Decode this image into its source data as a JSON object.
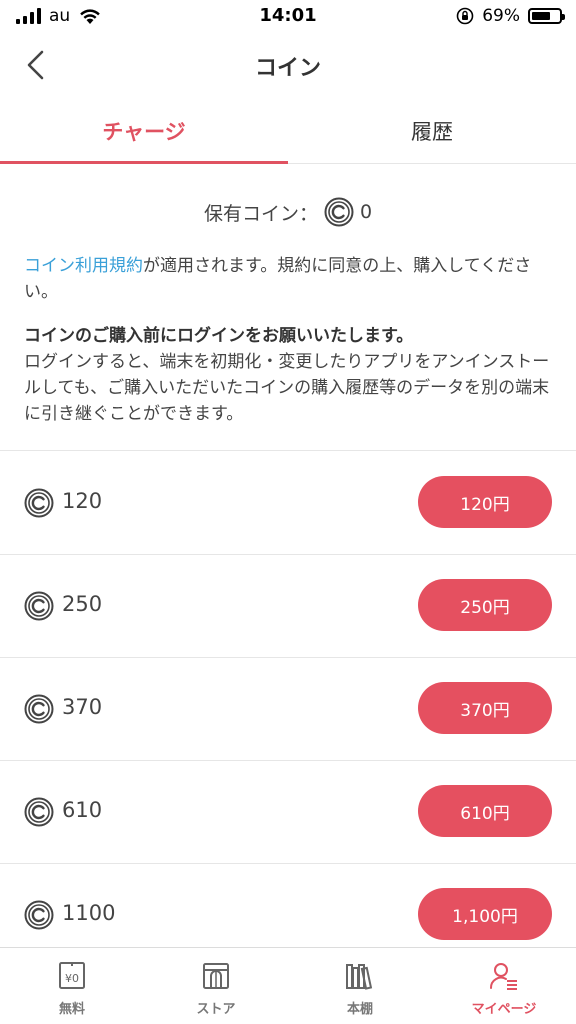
{
  "status_bar": {
    "carrier": "au",
    "time": "14:01",
    "battery_percent": "69%",
    "battery_level": 0.69
  },
  "header": {
    "title": "コイン",
    "back_icon": "chevron-left-icon"
  },
  "tabs": [
    {
      "label": "チャージ",
      "active": true
    },
    {
      "label": "履歴",
      "active": false
    }
  ],
  "info": {
    "owned_label": "保有コイン：",
    "owned_value": "0",
    "terms_link": "コイン利用規約",
    "terms_text": "が適用されます。規約に同意の上、購入してください。",
    "notice_bold": "コインのご購入前にログインをお願いいたします。",
    "notice_text": "ログインすると、端末を初期化・変更したりアプリをアンインストールしても、ご購入いただいたコインの購入履歴等のデータを別の端末に引き継ぐことができます。"
  },
  "coin_items": [
    {
      "amount": "120",
      "price": "120円"
    },
    {
      "amount": "250",
      "price": "250円"
    },
    {
      "amount": "370",
      "price": "370円"
    },
    {
      "amount": "610",
      "price": "610円"
    },
    {
      "amount": "1100",
      "price": "1,100円"
    }
  ],
  "bottom_nav": [
    {
      "label": "無料",
      "icon": "free-icon",
      "active": false
    },
    {
      "label": "ストア",
      "icon": "store-icon",
      "active": false
    },
    {
      "label": "本棚",
      "icon": "bookshelf-icon",
      "active": false
    },
    {
      "label": "マイページ",
      "icon": "mypage-icon",
      "active": true
    }
  ],
  "colors": {
    "accent": "#e05261",
    "button": "#e55060",
    "link": "#3aa0d8"
  }
}
